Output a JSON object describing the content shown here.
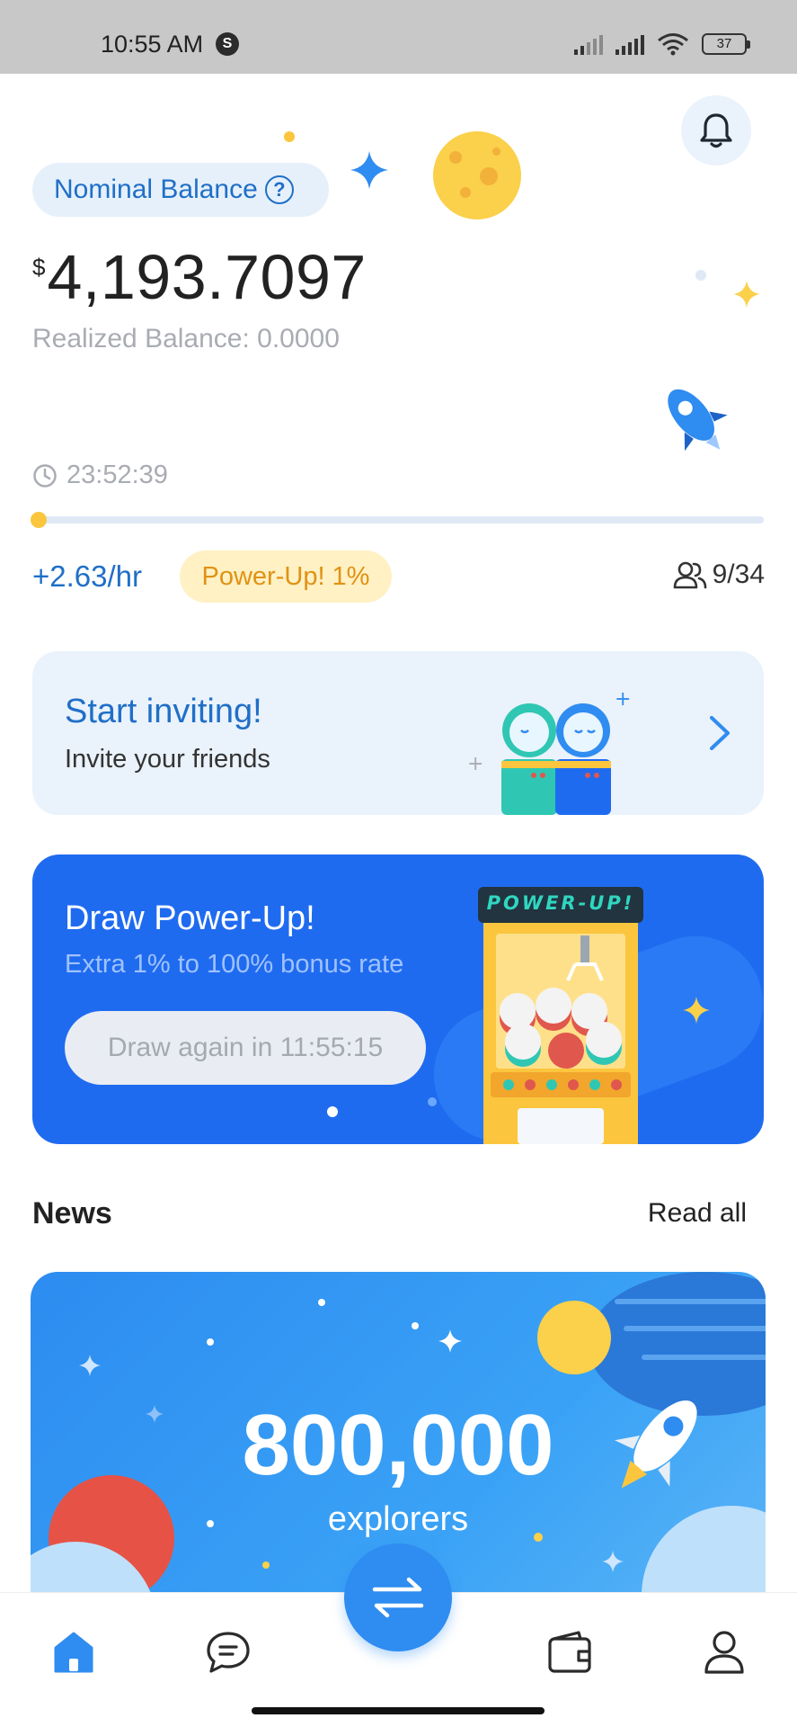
{
  "status_bar": {
    "time": "10:55 AM",
    "battery": "37",
    "icons": [
      "sim-s-icon",
      "signal-icon",
      "signal-icon",
      "wifi-icon",
      "battery-icon"
    ]
  },
  "header": {
    "notification_icon": "bell-icon"
  },
  "balance": {
    "nominal_label": "Nominal Balance",
    "help_icon": "?",
    "currency_symbol": "$",
    "amount": "4,193.7097",
    "realized": "Realized Balance: 0.0000",
    "timer": "23:52:39",
    "progress": 0.01,
    "rate": "+2.63/hr",
    "powerup_badge": "Power-Up! 1%",
    "friends_count": "9/34"
  },
  "invite_card": {
    "title": "Start inviting!",
    "subtitle": "Invite your friends"
  },
  "draw_card": {
    "title": "Draw Power-Up!",
    "subtitle": "Extra 1% to 100% bonus rate",
    "button": "Draw again in 11:55:15",
    "machine_label": "POWER-UP!"
  },
  "news": {
    "title": "News",
    "read_all": "Read all",
    "banner_number": "800,000",
    "banner_word": "explorers"
  },
  "bottom_nav": {
    "items": [
      "home-icon",
      "chat-icon",
      "swap-icon",
      "wallet-icon",
      "profile-icon"
    ],
    "active": "home"
  },
  "colors": {
    "brand_blue": "#1f6fc7",
    "card_blue": "#1f6bf0",
    "accent_yellow": "#fbc63e",
    "pill_bg": "#e6f0fb"
  }
}
